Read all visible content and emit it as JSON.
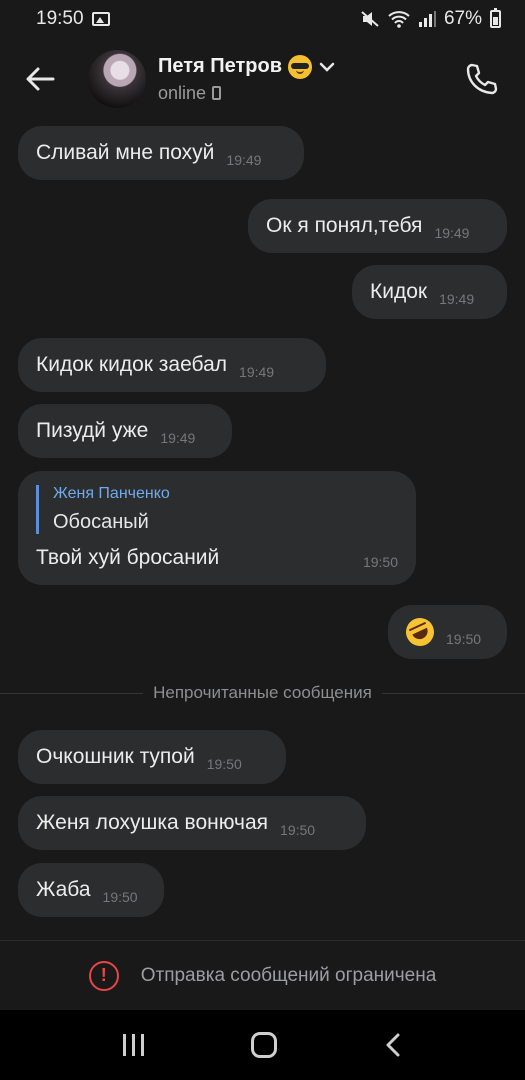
{
  "status_bar": {
    "time": "19:50",
    "battery": "67%"
  },
  "header": {
    "name": "Петя Петров",
    "status": "online"
  },
  "messages": [
    {
      "text": "Сливай мне похуй",
      "time": "19:49",
      "side": "in"
    },
    {
      "text": "Ок я понял,тебя",
      "time": "19:49",
      "side": "out"
    },
    {
      "text": "Кидок",
      "time": "19:49",
      "side": "out"
    },
    {
      "text": "Кидок кидок заебал",
      "time": "19:49",
      "side": "in"
    },
    {
      "text": "Пизудй уже",
      "time": "19:49",
      "side": "in"
    },
    {
      "quote_author": "Женя Панченко",
      "quote_text": "Обосаный",
      "text": "Твой хуй бросаний",
      "time": "19:50",
      "side": "in"
    },
    {
      "emoji": "rolling-laughing",
      "time": "19:50",
      "side": "out"
    },
    {
      "text": "Очкошник тупой",
      "time": "19:50",
      "side": "in"
    },
    {
      "text": "Женя лохушка вонючая",
      "time": "19:50",
      "side": "in"
    },
    {
      "text": "Жаба",
      "time": "19:50",
      "side": "in"
    }
  ],
  "unread_label": "Непрочитанные сообщения",
  "restricted_text": "Отправка сообщений ограничена",
  "colors": {
    "background": "#19191a",
    "bubble": "#2c2d2e",
    "accent": "#71aaeb",
    "warning": "#e64646"
  },
  "icons": [
    "gallery-icon",
    "mute-icon",
    "wifi-icon",
    "signal-icon",
    "battery-icon",
    "back-arrow-icon",
    "chevron-down-icon",
    "mobile-icon",
    "phone-icon",
    "warning-icon",
    "nav-recent-icon",
    "nav-home-icon",
    "nav-back-icon"
  ]
}
